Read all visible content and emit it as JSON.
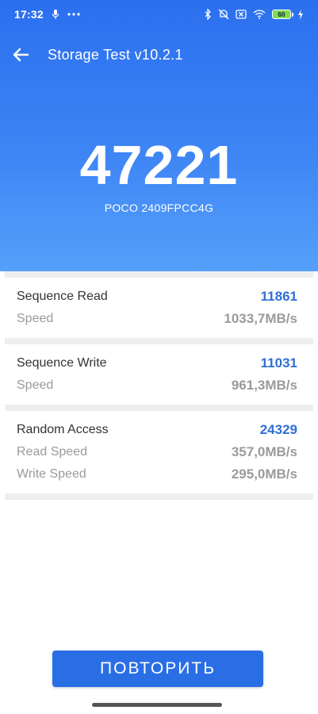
{
  "status_bar": {
    "time": "17:32",
    "battery_level": "60"
  },
  "app_bar": {
    "title": "Storage Test v10.2.1"
  },
  "hero": {
    "score": "47221",
    "device": "POCO 2409FPCC4G"
  },
  "results": [
    {
      "name": "Sequence Read",
      "score": "11861",
      "rows": [
        {
          "label": "Speed",
          "value": "1033,7MB/s"
        }
      ]
    },
    {
      "name": "Sequence Write",
      "score": "11031",
      "rows": [
        {
          "label": "Speed",
          "value": "961,3MB/s"
        }
      ]
    },
    {
      "name": "Random Access",
      "score": "24329",
      "rows": [
        {
          "label": "Read Speed",
          "value": "357,0MB/s"
        },
        {
          "label": "Write Speed",
          "value": "295,0MB/s"
        }
      ]
    }
  ],
  "retry_button": {
    "label": "ПОВТОРИТЬ"
  },
  "colors": {
    "hero_top": "#2b6ff0",
    "hero_bottom": "#55a0fb",
    "score_blue": "#2f6fd6",
    "button": "#2a6ee6"
  }
}
